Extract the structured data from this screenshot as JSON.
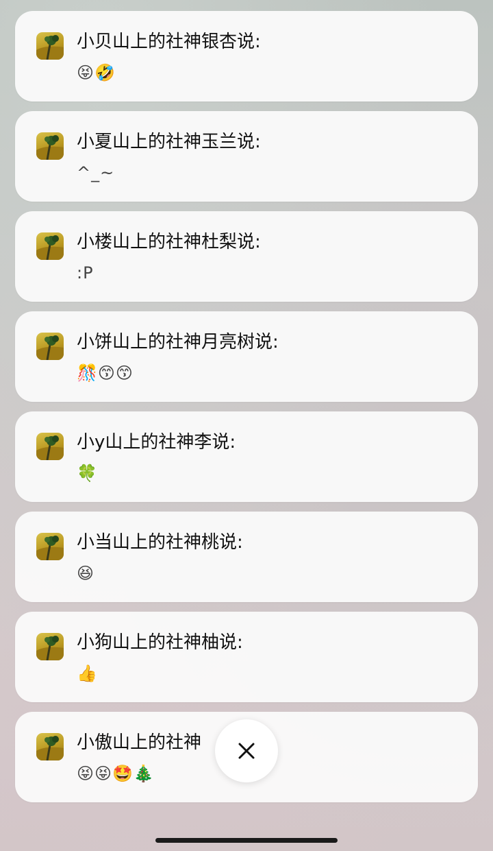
{
  "messages": [
    {
      "name": "小贝山上的社神银杏说:",
      "text": "😝🤣"
    },
    {
      "name": "小夏山上的社神玉兰说:",
      "text": "^_~"
    },
    {
      "name": "小楼山上的社神杜梨说:",
      "text": ":P"
    },
    {
      "name": "小饼山上的社神月亮树说:",
      "text": "🎊😙😙"
    },
    {
      "name": "小y山上的社神李说:",
      "text": "🍀"
    },
    {
      "name": "小当山上的社神桃说:",
      "text": "😆"
    },
    {
      "name": "小狗山上的社神柚说:",
      "text": "👍"
    },
    {
      "name": "小傲山上的社神",
      "text": "😝😝🤩🎄"
    }
  ],
  "avatar_icon": "tree-on-hill-icon",
  "close_icon": "close-icon",
  "colors": {
    "card_bg": "#fafafa",
    "text_primary": "#111111",
    "text_secondary": "#444444"
  }
}
